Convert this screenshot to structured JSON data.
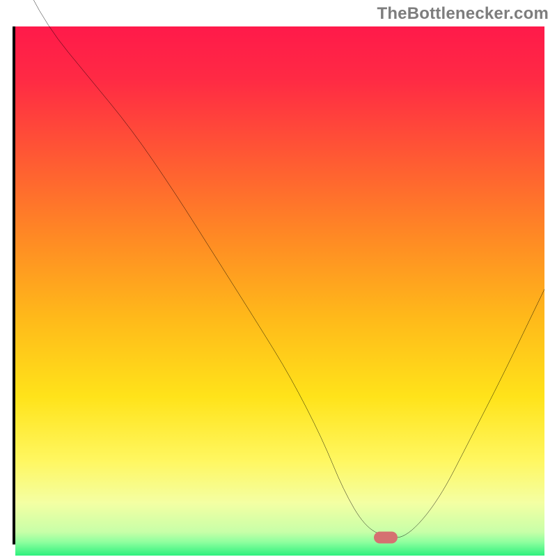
{
  "watermark": "TheBottlenecker.com",
  "colors": {
    "axis": "#000000",
    "curve": "#000000",
    "marker": "#d57171",
    "gradient_stops": [
      {
        "offset": 0.0,
        "color": "#ff1a4a"
      },
      {
        "offset": 0.1,
        "color": "#ff2a44"
      },
      {
        "offset": 0.25,
        "color": "#ff5a33"
      },
      {
        "offset": 0.4,
        "color": "#ff8a24"
      },
      {
        "offset": 0.55,
        "color": "#ffb91a"
      },
      {
        "offset": 0.7,
        "color": "#ffe31a"
      },
      {
        "offset": 0.82,
        "color": "#fff760"
      },
      {
        "offset": 0.9,
        "color": "#f4ffa3"
      },
      {
        "offset": 0.955,
        "color": "#c8ffa8"
      },
      {
        "offset": 0.975,
        "color": "#8dff9e"
      },
      {
        "offset": 1.0,
        "color": "#2df07d"
      }
    ]
  },
  "chart_data": {
    "type": "line",
    "title": "",
    "xlabel": "",
    "ylabel": "",
    "xlim": [
      0,
      100
    ],
    "ylim": [
      0,
      100
    ],
    "series": [
      {
        "name": "bottleneck-curve",
        "x": [
          0,
          6,
          14,
          22,
          30,
          38,
          46,
          52,
          58,
          62,
          66,
          70,
          74,
          80,
          86,
          92,
          100
        ],
        "y": [
          112,
          100,
          90,
          80,
          68,
          55,
          42,
          32,
          20,
          10,
          3,
          0.8,
          0.8,
          8,
          20,
          32,
          49
        ]
      }
    ],
    "marker": {
      "x": 70,
      "y": 0.8
    },
    "annotations": []
  }
}
